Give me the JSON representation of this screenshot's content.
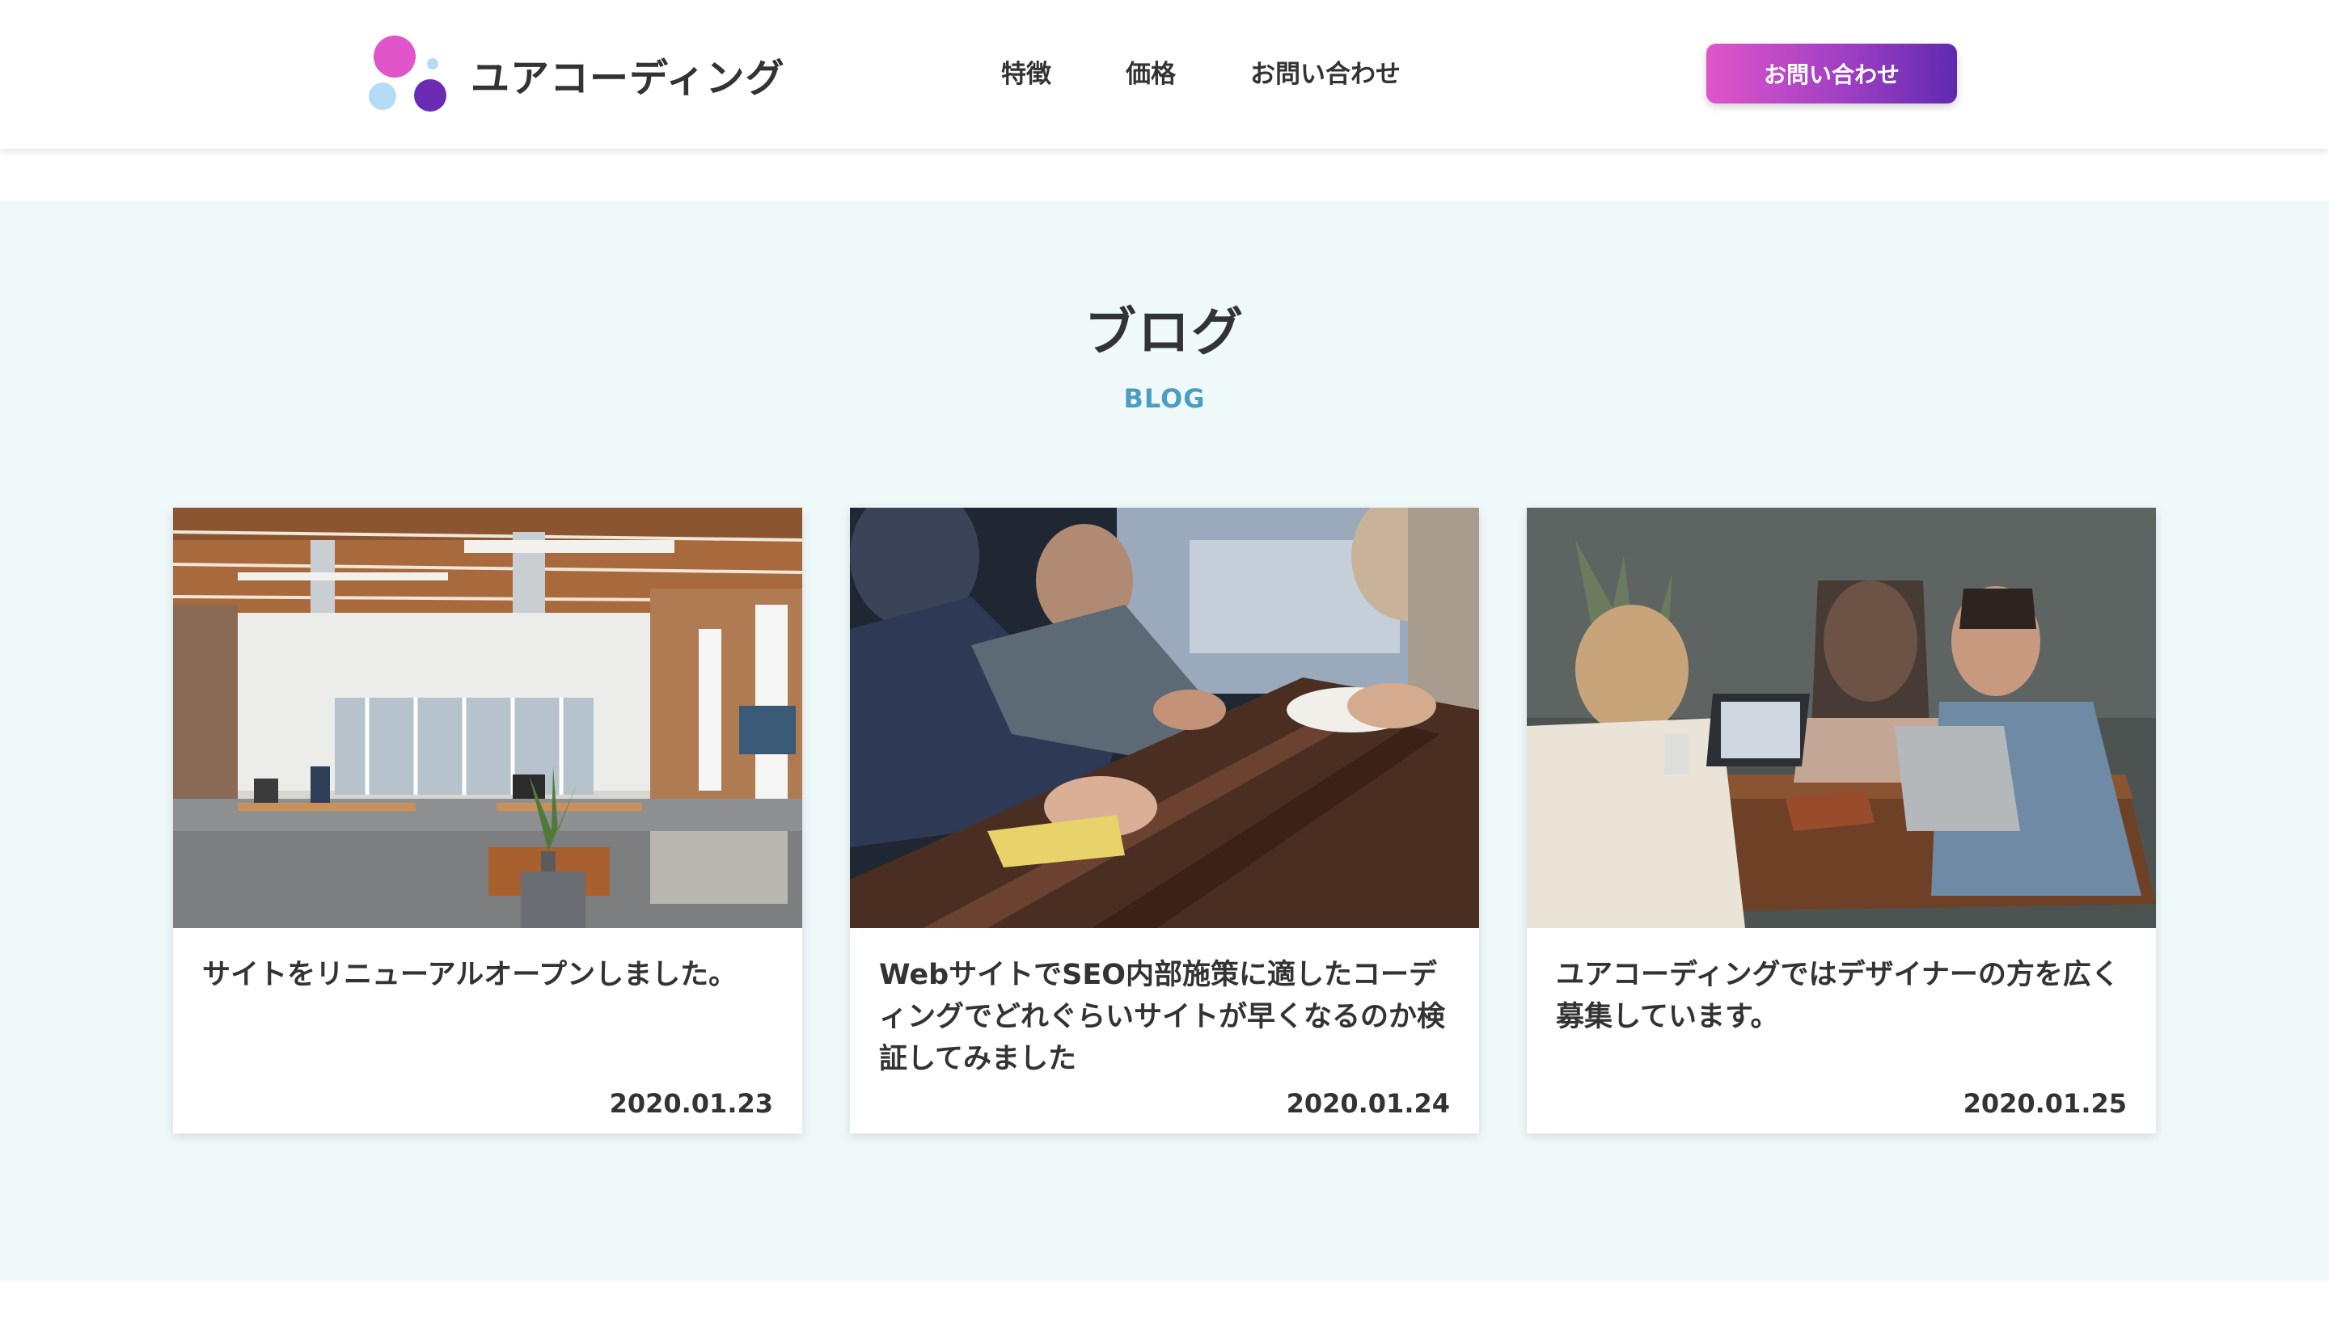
{
  "header": {
    "logo_text": "ユアコーディング",
    "nav": [
      "特徴",
      "価格",
      "お問い合わせ"
    ],
    "cta_label": "お問い合わせ"
  },
  "blog": {
    "title": "ブログ",
    "subtitle": "BLOG",
    "cards": [
      {
        "title": "サイトをリニューアルオープンしました。",
        "date": "2020.01.23",
        "image": "office-interior-photo"
      },
      {
        "title": "WebサイトでSEO内部施策に適したコーディングでどれぐらいサイトが早くなるのか検証してみました",
        "date": "2020.01.24",
        "image": "meeting-table-photo"
      },
      {
        "title": "ユアコーディングではデザイナーの方を広く募集しています。",
        "date": "2020.01.25",
        "image": "cafe-laptops-photo"
      }
    ]
  },
  "colors": {
    "brand_pink": "#e055c9",
    "brand_purple": "#5f2ab0",
    "accent_blue": "#4b9ec2",
    "section_bg": "#eff9fa"
  }
}
